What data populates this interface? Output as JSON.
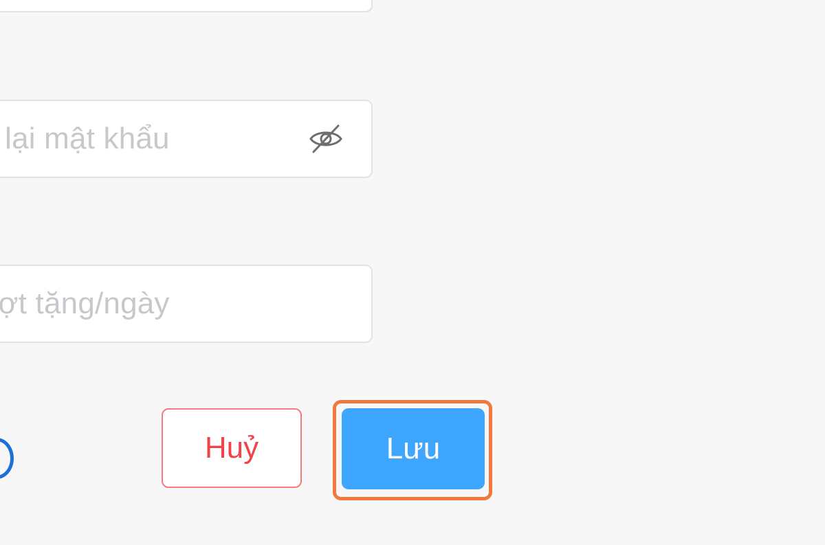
{
  "form": {
    "confirm_password": {
      "placeholder": "p lại mật khẩu",
      "visibility_icon": "eye-slash-icon"
    },
    "daily_gift": {
      "placeholder": "ượt tặng/ngày"
    },
    "actions": {
      "cancel_label": "Huỷ",
      "save_label": "Lưu"
    }
  },
  "colors": {
    "background": "#f7f7f8",
    "save_button": "#3fa6ff",
    "cancel_text": "#f0434a",
    "highlight": "#f4773f",
    "radio": "#1e6fd9"
  }
}
